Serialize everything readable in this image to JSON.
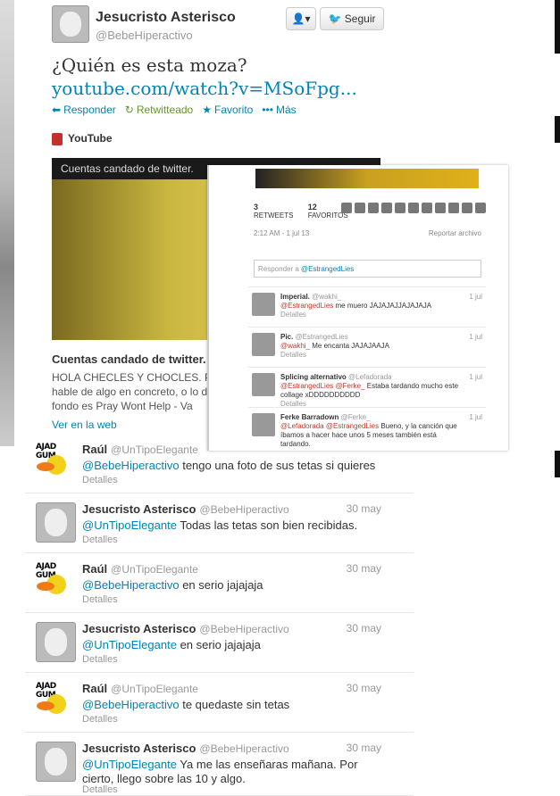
{
  "main_tweet": {
    "name": "Jesucristo Asterisco",
    "handle": "@BebeHiperactivo",
    "follow_label": "Seguir",
    "text_plain": "¿Quién es esta moza? ",
    "link_text": "youtube.com/watch?v=MSoFpg...",
    "actions": {
      "reply": "Responder",
      "retweet": "Retwitteado",
      "favorite": "Favorito",
      "more": "Más"
    },
    "media_source": "YouTube",
    "card": {
      "bar_title": "Cuentas candado de twitter.",
      "title": "Cuentas candado de twitter.",
      "description": "HOLA CHECLES Y CHOCLES. P hable de algo en concreto, o lo de fondo es Pray Wont Help - Va",
      "link": "Ver en la web"
    }
  },
  "overlay": {
    "retweets_count": "3",
    "retweets_label": "RETWEETS",
    "favorites_count": "12",
    "favorites_label": "FAVORITOS",
    "timestamp": "2:12 AM - 1 jul 13",
    "report": "Reportar archivo",
    "reply_prefix": "Responder a ",
    "reply_handle": "@EstrangedLies",
    "items": [
      {
        "name": "Imperial.",
        "handle": "@wakhi_",
        "date": "1 jul",
        "mention": "@EstrangedLies",
        "text": " me muero JAJAJAJJAJAJAJA",
        "details": "Detalles"
      },
      {
        "name": "Pic.",
        "handle": "@EstrangedLies",
        "date": "1 jul",
        "mention": "@wakhi_",
        "text": " Me encanta JAJAJAAJA",
        "details": "Detalles"
      },
      {
        "name": "Splicing alternativo",
        "handle": "@Lefadorada",
        "date": "1 jul",
        "mention": "@EstrangedLies @Ferke_",
        "text": " Estaba tardando mucho este collage xDDDDDDDDDD",
        "details": "Detalles"
      },
      {
        "name": "Ferke Barradown",
        "handle": "@Ferke_",
        "date": "1 jul",
        "mention": "@Lefadorada @EstrangedLies",
        "text": " Bueno, y la canción que íbamos a hacer hace unos 5 meses también está tardando.",
        "details": ""
      }
    ]
  },
  "thread": [
    {
      "name": "Raúl",
      "handle": "@UnTipoElegante",
      "date": "",
      "mention": "@BebeHiperactivo",
      "text": " tengo una foto de sus tetas si quieres",
      "details": "Detalles",
      "avatar": "duck"
    },
    {
      "name": "Jesucristo Asterisco",
      "handle": "@BebeHiperactivo",
      "date": "30 may",
      "mention": "@UnTipoElegante",
      "text": " Todas las tetas son bien recibidas.",
      "details": "Detalles",
      "avatar": "face"
    },
    {
      "name": "Raúl",
      "handle": "@UnTipoElegante",
      "date": "30 may",
      "mention": "@BebeHiperactivo",
      "text": " en serio jajajaja",
      "details": "Detalles",
      "avatar": "duck"
    },
    {
      "name": "Jesucristo Asterisco",
      "handle": "@BebeHiperactivo",
      "date": "30 may",
      "mention": "@UnTipoElegante",
      "text": " en serio jajajaja",
      "details": "Detalles",
      "avatar": "face"
    },
    {
      "name": "Raúl",
      "handle": "@UnTipoElegante",
      "date": "30 may",
      "mention": "@BebeHiperactivo",
      "text": " te quedaste sin tetas",
      "details": "Detalles",
      "avatar": "duck"
    },
    {
      "name": "Jesucristo Asterisco",
      "handle": "@BebeHiperactivo",
      "date": "30 may",
      "mention": "@UnTipoElegante",
      "text": " Ya me las enseñaras mañana. Por cierto, llego sobre las 10 y algo.",
      "details": "Detalles",
      "avatar": "face"
    }
  ],
  "duck_avatar_text": "AJAD GUM",
  "colors": {
    "link": "#0084b4",
    "muted": "#999999",
    "mention_red": "#c0392b"
  }
}
